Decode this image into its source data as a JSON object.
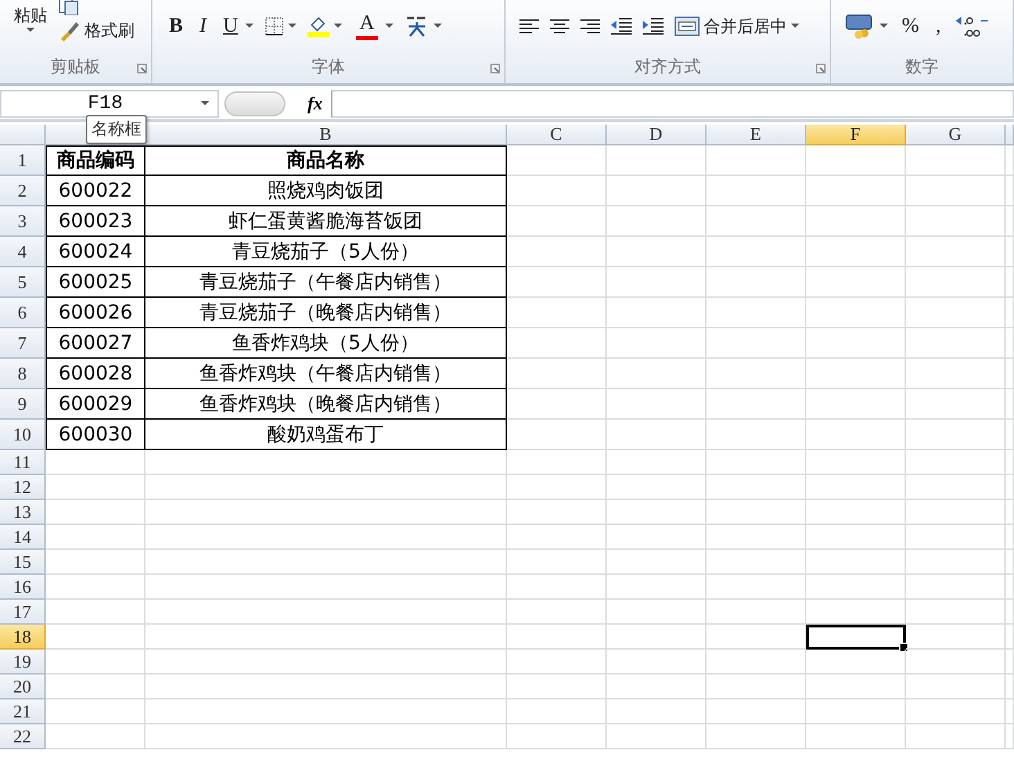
{
  "ribbon": {
    "groups": [
      {
        "label": "剪贴板",
        "items": [
          {
            "kind": "big",
            "label": "粘贴"
          },
          {
            "kind": "icon"
          },
          {
            "kind": "small",
            "label": "格式刷"
          }
        ]
      },
      {
        "label": "字体",
        "items": [
          {
            "kind": "glyph",
            "label": "B"
          },
          {
            "kind": "glyph",
            "label": "I"
          },
          {
            "kind": "glyph",
            "label": "U"
          },
          {
            "kind": "icon"
          },
          {
            "kind": "icon"
          },
          {
            "kind": "glyph",
            "label": "A"
          },
          {
            "kind": "icon"
          }
        ]
      },
      {
        "label": "对齐方式",
        "items": [
          {
            "kind": "icon"
          },
          {
            "kind": "icon"
          },
          {
            "kind": "icon"
          },
          {
            "kind": "icon"
          },
          {
            "kind": "icon"
          },
          {
            "kind": "small",
            "label": "合并后居中"
          }
        ]
      },
      {
        "label": "数字",
        "items": [
          {
            "kind": "icon"
          },
          {
            "kind": "glyph",
            "label": "%"
          },
          {
            "kind": "glyph",
            "label": ","
          },
          {
            "kind": "icon"
          }
        ]
      }
    ]
  },
  "formula_bar": {
    "name_box": "F18",
    "fx": "fx",
    "tooltip": "名称框"
  },
  "sheet": {
    "columns": [
      {
        "selected": false
      },
      {
        "label": "B",
        "selected": false
      },
      {
        "label": "C",
        "selected": false
      },
      {
        "label": "D",
        "selected": false
      },
      {
        "label": "E",
        "selected": false
      },
      {
        "label": "F",
        "selected": true
      },
      {
        "label": "G",
        "selected": false
      }
    ],
    "rows": [
      {
        "header": "1",
        "selected": false,
        "kind": "header",
        "cells": [
          "商品编码",
          "商品名称"
        ]
      },
      {
        "header": "2",
        "selected": false,
        "kind": "data",
        "cells": [
          "600022",
          "照烧鸡肉饭团"
        ]
      },
      {
        "header": "3",
        "selected": false,
        "kind": "data",
        "cells": [
          "600023",
          "虾仁蛋黄酱脆海苔饭团"
        ]
      },
      {
        "header": "4",
        "selected": false,
        "kind": "data",
        "cells": [
          "600024",
          "青豆烧茄子（5人份）"
        ]
      },
      {
        "header": "5",
        "selected": false,
        "kind": "data",
        "cells": [
          "600025",
          "青豆烧茄子（午餐店内销售）"
        ]
      },
      {
        "header": "6",
        "selected": false,
        "kind": "data",
        "cells": [
          "600026",
          "青豆烧茄子（晚餐店内销售）"
        ]
      },
      {
        "header": "7",
        "selected": false,
        "kind": "data",
        "cells": [
          "600027",
          "鱼香炸鸡块（5人份）"
        ]
      },
      {
        "header": "8",
        "selected": false,
        "kind": "data",
        "cells": [
          "600028",
          "鱼香炸鸡块（午餐店内销售）"
        ]
      },
      {
        "header": "9",
        "selected": false,
        "kind": "data",
        "cells": [
          "600029",
          "鱼香炸鸡块（晚餐店内销售）"
        ]
      },
      {
        "header": "10",
        "selected": false,
        "kind": "data",
        "cells": [
          "600030",
          "酸奶鸡蛋布丁"
        ]
      },
      {
        "header": "11",
        "selected": false,
        "kind": "empty"
      },
      {
        "header": "12",
        "selected": false,
        "kind": "empty"
      },
      {
        "header": "13",
        "selected": false,
        "kind": "empty"
      },
      {
        "header": "14",
        "selected": false,
        "kind": "empty"
      },
      {
        "header": "15",
        "selected": false,
        "kind": "empty"
      },
      {
        "header": "16",
        "selected": false,
        "kind": "empty"
      },
      {
        "header": "17",
        "selected": false,
        "kind": "empty"
      },
      {
        "header": "18",
        "selected": true,
        "kind": "empty"
      },
      {
        "header": "19",
        "selected": false,
        "kind": "empty"
      },
      {
        "header": "20",
        "selected": false,
        "kind": "empty"
      },
      {
        "header": "21",
        "selected": false,
        "kind": "empty"
      },
      {
        "header": "22",
        "selected": false,
        "kind": "empty"
      }
    ]
  }
}
